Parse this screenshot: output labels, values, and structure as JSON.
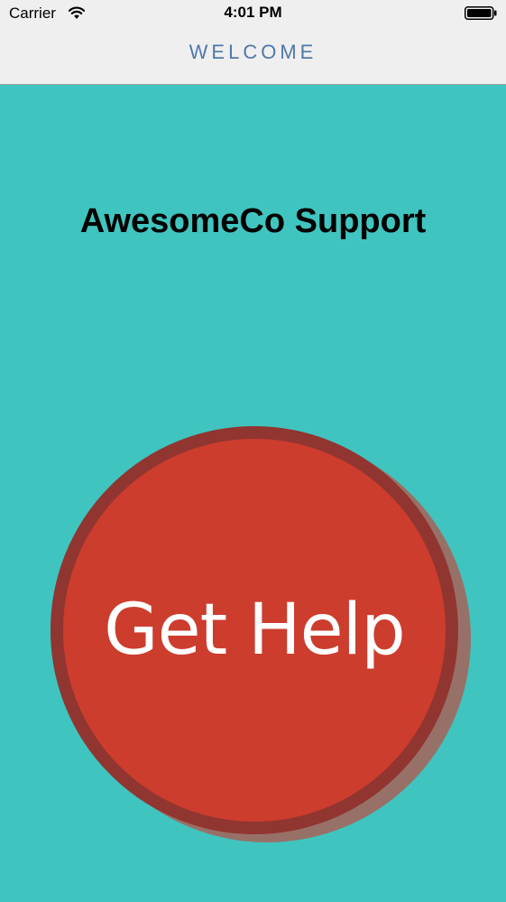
{
  "status_bar": {
    "carrier": "Carrier",
    "time": "4:01 PM",
    "wifi_icon": "wifi-icon",
    "battery_icon": "battery-icon"
  },
  "nav": {
    "title": "WELCOME"
  },
  "main": {
    "title": "AwesomeCo Support",
    "help_button_label": "Get Help"
  },
  "colors": {
    "background": "#40c4bf",
    "nav_background": "#efefef",
    "nav_title": "#4f79a8",
    "button_fill": "#cc3d2e",
    "button_ring": "#913530",
    "button_shadow": "#977168"
  }
}
